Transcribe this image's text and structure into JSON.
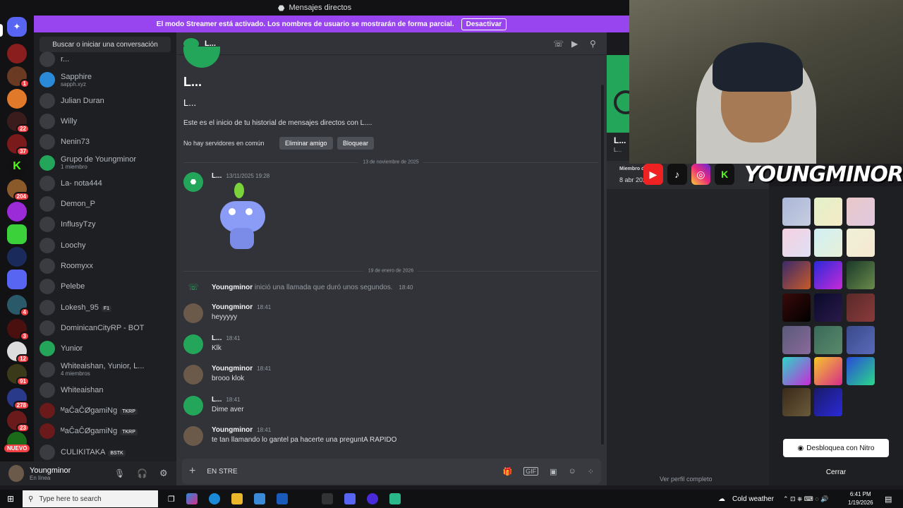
{
  "window": {
    "title": "Mensajes directos"
  },
  "streamer_banner": {
    "text": "El modo Streamer está activado. Los nombres de usuario se mostrarán de forma parcial.",
    "button": "Desactivar"
  },
  "rail": {
    "badges": [
      "1",
      "22",
      "37",
      "204",
      "4",
      "3",
      "12",
      "91",
      "278",
      "23"
    ],
    "new_label": "NUEVO"
  },
  "dm": {
    "search_placeholder": "Buscar o iniciar una conversación",
    "items": [
      {
        "name": "r...",
        "sub": ""
      },
      {
        "name": "Sapphire",
        "sub": "sapph.xyz"
      },
      {
        "name": "Julian Duran",
        "sub": ""
      },
      {
        "name": "Willy",
        "sub": ""
      },
      {
        "name": "Nenin73",
        "sub": ""
      },
      {
        "name": "Grupo de Youngminor",
        "sub": "1 miembro"
      },
      {
        "name": "La- nota444",
        "sub": ""
      },
      {
        "name": "Demon_P",
        "sub": ""
      },
      {
        "name": "InflusyTzy",
        "sub": ""
      },
      {
        "name": "Loochy",
        "sub": ""
      },
      {
        "name": "Roomyxx",
        "sub": ""
      },
      {
        "name": "Pelebe",
        "sub": ""
      },
      {
        "name": "Lokesh_95",
        "sub": "",
        "tag": "F1"
      },
      {
        "name": "DominicanCityRP - BOT",
        "sub": ""
      },
      {
        "name": "Yunior",
        "sub": ""
      },
      {
        "name": "Whiteaishan, Yunior, L...",
        "sub": "4 miembros"
      },
      {
        "name": "Whiteaishan",
        "sub": ""
      },
      {
        "name": "ᴹaĈaĈØgamiNg",
        "sub": "",
        "tag": "TKRP"
      },
      {
        "name": "ᴹaĈaĈØgamiNg",
        "sub": "",
        "tag": "TKRP"
      },
      {
        "name": "CULIKITAKA",
        "sub": "",
        "tag": "BSTK"
      }
    ]
  },
  "user": {
    "name": "Youngminor",
    "status": "En línea"
  },
  "chat": {
    "header_name": "L...",
    "intro_name": "L...",
    "intro_handle": "L...",
    "intro_text": "Este es el inicio de tu historial de mensajes directos con L....",
    "no_servers": "No hay servidores en común",
    "remove_friend": "Eliminar amigo",
    "block": "Bloquear",
    "date1": "13 de noviembre de 2025",
    "date2": "19 de enero de 2026",
    "first_msg": {
      "author": "L...",
      "time": "13/11/2025 19:28"
    },
    "call": {
      "author": "Youngminor",
      "text": "inició una llamada que duró unos segundos.",
      "time": "18:40"
    },
    "messages": [
      {
        "author": "Youngminor",
        "time": "18:41",
        "text": "heyyyyy"
      },
      {
        "author": "L...",
        "time": "18:41",
        "text": "Klk"
      },
      {
        "author": "Youngminor",
        "time": "18:41",
        "text": "brooo klok"
      },
      {
        "author": "L...",
        "time": "18:41",
        "text": "Dime aver"
      },
      {
        "author": "Youngminor",
        "time": "18:41",
        "text": "te tan llamando lo gantel pa hacerte una preguntA RAPIDO"
      }
    ],
    "composer_value": "EN STRE"
  },
  "profile": {
    "name": "L...",
    "handle": "L...",
    "member_since_label": "Miembro d",
    "member_since_value": "8 abr 202",
    "view_full": "Ver perfil completo"
  },
  "overlay": {
    "brand": "YOUNGMINOR"
  },
  "nitro": {
    "unlock": "Desbloquea con Nitro",
    "close": "Cerrar"
  },
  "taskbar": {
    "search": "Type here to search",
    "weather": "Cold weather",
    "time": "6:41 PM",
    "date": "1/19/2026"
  },
  "colors": {
    "accent": "#5865f2",
    "banner": "#9845f0",
    "online": "#23a55a",
    "badge": "#f23f43"
  }
}
